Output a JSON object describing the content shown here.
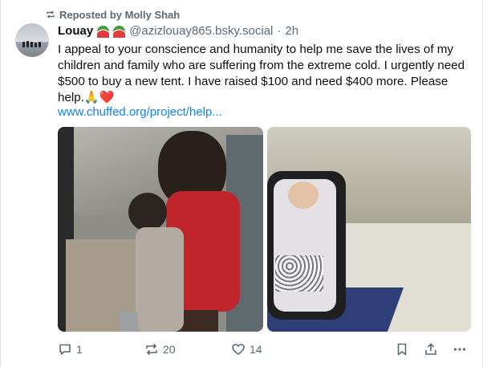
{
  "repost": {
    "label": "Reposted by Molly Shah"
  },
  "author": {
    "name": "Louay",
    "handle": "@azizlouay865.bsky.social",
    "separator": "·",
    "time": "2h"
  },
  "post": {
    "text": "I appeal to your conscience and humanity to help me save the lives of my children and family who are suffering from the extreme cold. I urgently need $500 to buy a new tent. I have raised $100 and need $400 more. Please help.🙏❤️",
    "link": "www.chuffed.org/project/help..."
  },
  "actions": {
    "replies": "1",
    "reposts": "20",
    "likes": "14"
  },
  "colors": {
    "link": "#1083fe",
    "muted": "#5a6a7b",
    "text": "#0b0f14"
  }
}
